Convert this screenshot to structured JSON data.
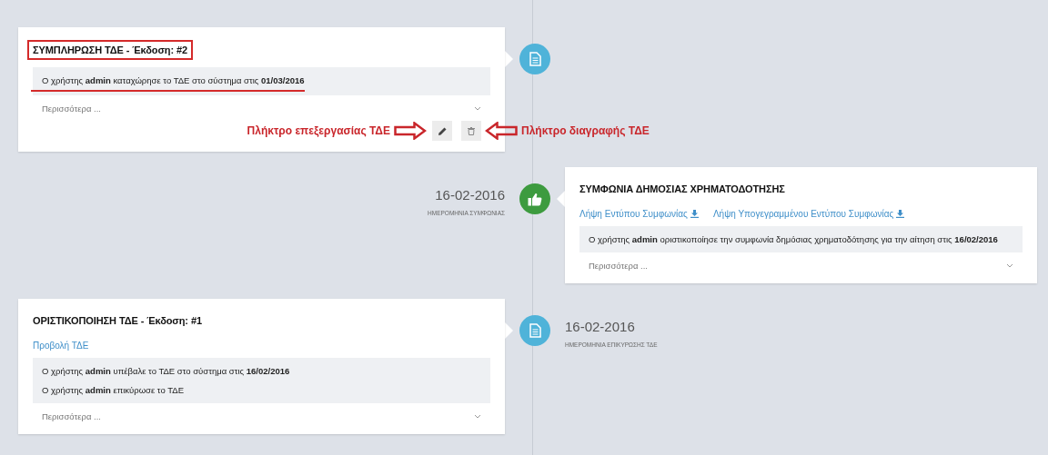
{
  "timeline": [
    {
      "kind": "document",
      "color": "#4fb3d9",
      "title": "ΣΥΜΠΛΗΡΩΣΗ ΤΔΕ - Έκδοση: #2",
      "title_boxed": true,
      "log": [
        {
          "text": "Ο χρήστης **admin** καταχώρησε το ΤΔΕ στο σύστημα στις **01/03/2016**",
          "underlined": true
        }
      ],
      "more": "Περισσότερα ...",
      "actions": [
        {
          "kind": "edit",
          "callout": "Πλήκτρο επεξεργασίας ΤΔΕ"
        },
        {
          "kind": "delete",
          "callout": "Πλήκτρο διαγραφής ΤΔΕ"
        }
      ]
    },
    {
      "kind": "agreement",
      "color": "#3d9b3f",
      "date": "16-02-2016",
      "date_label": "ΗΜΕΡΟΜΗΝΙΑ ΣΥΜΦΩΝΙΑΣ",
      "title": "ΣΥΜΦΩΝΙΑ ΔΗΜΟΣΙΑΣ ΧΡΗΜΑΤΟΔΟΤΗΣΗΣ",
      "links": [
        {
          "text": "Λήψη Εντύπου Συμφωνίας",
          "kind": "download"
        },
        {
          "text": "Λήψη Υπογεγραμμένου Εντύπου Συμφωνίας",
          "kind": "download"
        }
      ],
      "log": [
        {
          "text": "Ο χρήστης **admin** οριστικοποίησε την συμφωνία δημόσιας χρηματοδότησης για την αίτηση στις **16/02/2016**",
          "underlined": false
        }
      ],
      "more": "Περισσότερα ..."
    },
    {
      "kind": "document",
      "color": "#4fb3d9",
      "date": "16-02-2016",
      "date_label": "ΗΜΕΡΟΜΗΝΙΑ ΕΠΙΚΥΡΩΣΗΣ ΤΔΕ",
      "title": "ΟΡΙΣΤΙΚΟΠΟΙΗΣΗ ΤΔΕ - Έκδοση: #1",
      "title_boxed": false,
      "links": [
        {
          "text": "Προβολή ΤΔΕ",
          "kind": "view"
        }
      ],
      "log": [
        {
          "text": "Ο χρήστης **admin** υπέβαλε το ΤΔΕ στο σύστημα στις **16/02/2016**",
          "underlined": false
        },
        {
          "text": "Ο χρήστης **admin** επικύρωσε το ΤΔΕ",
          "underlined": false
        }
      ],
      "more": "Περισσότερα ..."
    }
  ]
}
